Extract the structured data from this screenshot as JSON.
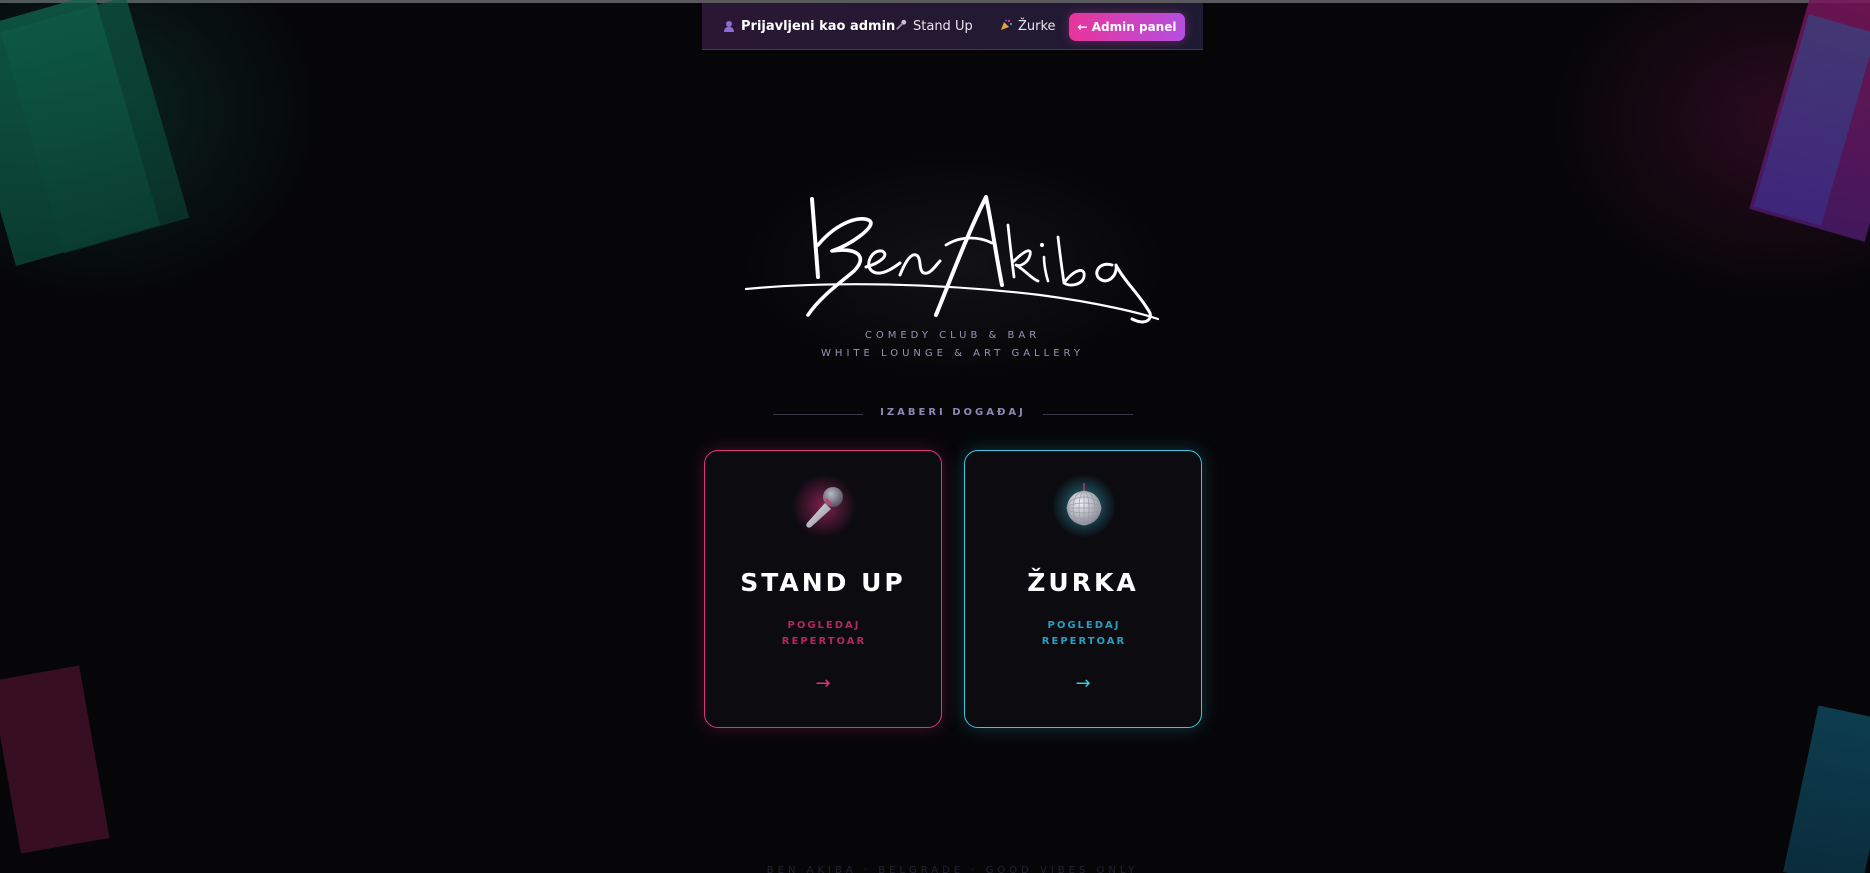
{
  "nav": {
    "user_label": "Prijavljeni kao admin",
    "user_icon": "user-icon",
    "standup_label": "Stand Up",
    "standup_icon": "microphone-icon",
    "zurke_label": "Žurke",
    "zurke_icon": "party-popper-icon",
    "admin_button_label": "← Admin panel"
  },
  "logo": {
    "signature_text": "Ben Akiba",
    "tagline_1": "COMEDY CLUB & BAR",
    "tagline_2": "WHITE LOUNGE & ART GALLERY"
  },
  "section": {
    "title": "IZABERI DOGAĐAJ"
  },
  "cards": [
    {
      "title": "STAND UP",
      "subtitle_line1": "POGLEDAJ",
      "subtitle_line2": "REPERTOAR",
      "arrow": "→",
      "icon": "microphone-icon",
      "accent": "#e0337f"
    },
    {
      "title": "ŽURKA",
      "subtitle_line1": "POGLEDAJ",
      "subtitle_line2": "REPERTOAR",
      "arrow": "→",
      "icon": "disco-ball-icon",
      "accent": "#3ac6e0"
    }
  ],
  "footer": {
    "text": "BEN AKIBA · BELGRADE · GOOD VIBES ONLY"
  },
  "colors": {
    "background": "#060609",
    "pink": "#e0337f",
    "cyan": "#3ac6e0",
    "admin_gradient_start": "#e8359a",
    "admin_gradient_end": "#b44fe0"
  }
}
